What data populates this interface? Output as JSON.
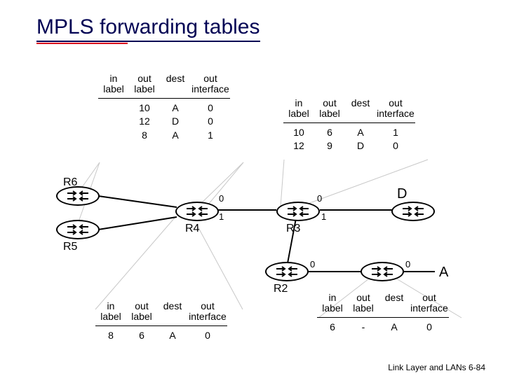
{
  "title": "MPLS forwarding tables",
  "footer": "Link Layer and LANs   6-84",
  "headers": {
    "in_label": "in\nlabel",
    "out_label": "out\nlabel",
    "dest": "dest",
    "out_interface": "out\ninterface"
  },
  "tables": {
    "t1": {
      "rows": [
        {
          "in_label": "",
          "out_label": "10",
          "dest": "A",
          "out_interface": "0"
        },
        {
          "in_label": "",
          "out_label": "12",
          "dest": "D",
          "out_interface": "0"
        },
        {
          "in_label": "",
          "out_label": "8",
          "dest": "A",
          "out_interface": "1"
        }
      ]
    },
    "t2": {
      "rows": [
        {
          "in_label": "10",
          "out_label": "6",
          "dest": "A",
          "out_interface": "1"
        },
        {
          "in_label": "12",
          "out_label": "9",
          "dest": "D",
          "out_interface": "0"
        }
      ]
    },
    "t3": {
      "rows": [
        {
          "in_label": "8",
          "out_label": "6",
          "dest": "A",
          "out_interface": "0"
        }
      ]
    },
    "t4": {
      "rows": [
        {
          "in_label": "6",
          "out_label": "-",
          "dest": "A",
          "out_interface": "0"
        }
      ]
    }
  },
  "routers": {
    "r6": "R6",
    "r5": "R5",
    "r4": "R4",
    "r3": "R3",
    "r2": "R2"
  },
  "endpoints": {
    "d": "D",
    "a": "A"
  },
  "ports": {
    "p0": "0",
    "p1": "1"
  }
}
